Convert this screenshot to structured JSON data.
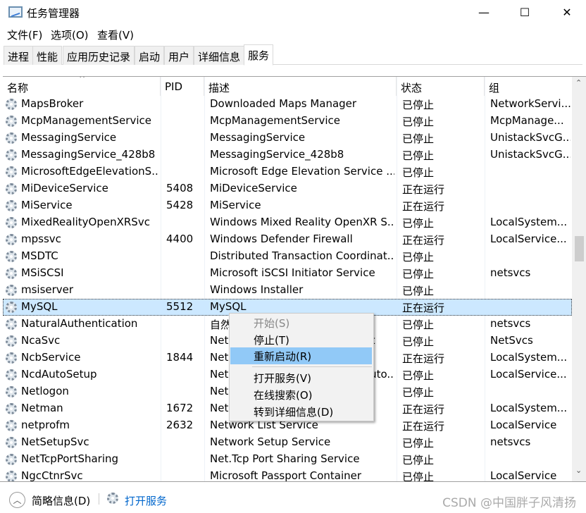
{
  "window": {
    "title": "任务管理器",
    "minimize": "—",
    "maximize": "☐",
    "close": "✕"
  },
  "menubar": [
    "文件(F)",
    "选项(O)",
    "查看(V)"
  ],
  "tabs": [
    {
      "label": "进程"
    },
    {
      "label": "性能"
    },
    {
      "label": "应用历史记录"
    },
    {
      "label": "启动"
    },
    {
      "label": "用户"
    },
    {
      "label": "详细信息"
    },
    {
      "label": "服务",
      "active": true
    }
  ],
  "columns": [
    "名称",
    "PID",
    "描述",
    "状态",
    "组"
  ],
  "sort_indicator": "^",
  "rows": [
    [
      "MapsBroker",
      "",
      "Downloaded Maps Manager",
      "已停止",
      "NetworkServi..."
    ],
    [
      "McpManagementService",
      "",
      "McpManagementService",
      "已停止",
      "McpManage..."
    ],
    [
      "MessagingService",
      "",
      "MessagingService",
      "已停止",
      "UnistackSvcG..."
    ],
    [
      "MessagingService_428b8",
      "",
      "MessagingService_428b8",
      "已停止",
      "UnistackSvcG..."
    ],
    [
      "MicrosoftEdgeElevationS...",
      "",
      "Microsoft Edge Elevation Service ...",
      "已停止",
      ""
    ],
    [
      "MiDeviceService",
      "5408",
      "MiDeviceService",
      "正在运行",
      ""
    ],
    [
      "MiService",
      "5428",
      "MiService",
      "正在运行",
      ""
    ],
    [
      "MixedRealityOpenXRSvc",
      "",
      "Windows Mixed Reality OpenXR S...",
      "已停止",
      "LocalSystem..."
    ],
    [
      "mpssvc",
      "4400",
      "Windows Defender Firewall",
      "正在运行",
      "LocalService..."
    ],
    [
      "MSDTC",
      "",
      "Distributed Transaction Coordinat...",
      "已停止",
      ""
    ],
    [
      "MSiSCSI",
      "",
      "Microsoft iSCSI Initiator Service",
      "已停止",
      "netsvcs"
    ],
    [
      "msiserver",
      "",
      "Windows Installer",
      "已停止",
      ""
    ],
    [
      "MySQL",
      "5512",
      "MySQL",
      "正在运行",
      ""
    ],
    [
      "NaturalAuthentication",
      "",
      "自然身份验证",
      "已停止",
      "netsvcs"
    ],
    [
      "NcaSvc",
      "",
      "Network Connectivity Assistant",
      "已停止",
      "NetSvcs"
    ],
    [
      "NcbService",
      "1844",
      "Network Connection Broker",
      "正在运行",
      "LocalSystem..."
    ],
    [
      "NcdAutoSetup",
      "",
      "Network Connected Devices Auto...",
      "已停止",
      "LocalService..."
    ],
    [
      "Netlogon",
      "",
      "Netlogon",
      "已停止",
      ""
    ],
    [
      "Netman",
      "1672",
      "Network Connections",
      "正在运行",
      "LocalSystem..."
    ],
    [
      "netprofm",
      "2632",
      "Network List Service",
      "正在运行",
      "LocalService"
    ],
    [
      "NetSetupSvc",
      "",
      "Network Setup Service",
      "已停止",
      "netsvcs"
    ],
    [
      "NetTcpPortSharing",
      "",
      "Net.Tcp Port Sharing Service",
      "已停止",
      ""
    ],
    [
      "NgcCtnrSvc",
      "",
      "Microsoft Passport Container",
      "已停止",
      "LocalService"
    ]
  ],
  "selected_row": "MySQL",
  "context_menu": {
    "items": [
      {
        "label": "开始(S)",
        "disabled": true
      },
      {
        "label": "停止(T)"
      },
      {
        "label": "重新启动(R)",
        "highlighted": true
      },
      {
        "label": "打开服务(V)"
      },
      {
        "label": "在线搜索(O)"
      },
      {
        "label": "转到详细信息(D)"
      }
    ]
  },
  "footer": {
    "fewer_details": "简略信息(D)",
    "open_services": "打开服务",
    "watermark": "CSDN @中国胖子风清扬"
  },
  "colors": {
    "selection": "#cce8ff",
    "menu_highlight": "#91c9f7",
    "link": "#0066cc"
  }
}
